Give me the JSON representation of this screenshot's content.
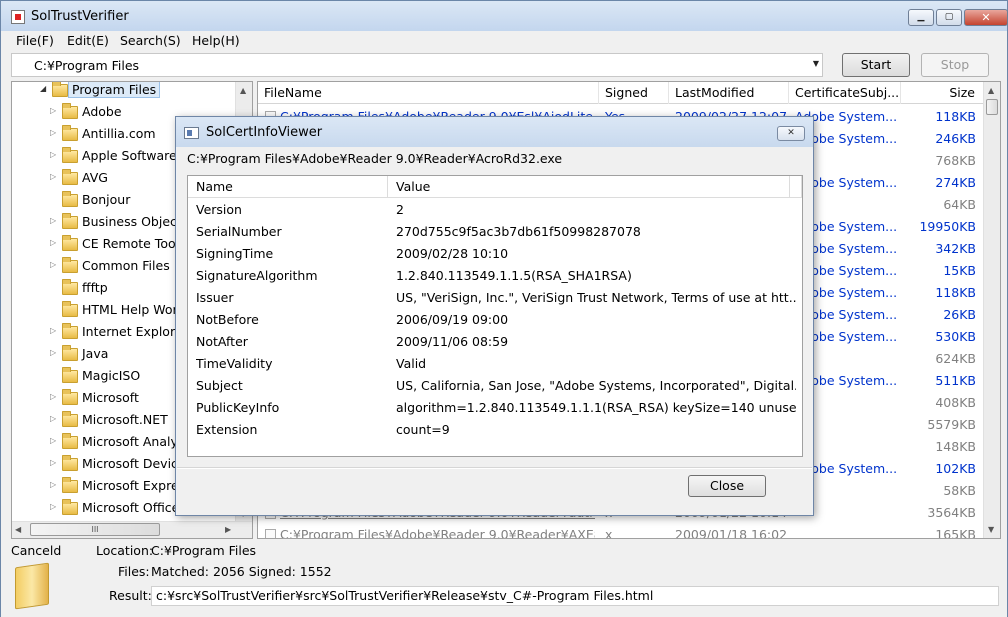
{
  "window": {
    "title": "SolTrustVerifier"
  },
  "menu": [
    "File(F)",
    "Edit(E)",
    "Search(S)",
    "Help(H)"
  ],
  "path_combo": {
    "value": "C:¥Program Files"
  },
  "buttons": {
    "start": "Start",
    "stop": "Stop"
  },
  "tree": {
    "root": "Program Files",
    "items": [
      {
        "label": "Adobe",
        "expandable": true
      },
      {
        "label": "Antillia.com",
        "expandable": true
      },
      {
        "label": "Apple Software",
        "expandable": true
      },
      {
        "label": "AVG",
        "expandable": true
      },
      {
        "label": "Bonjour",
        "expandable": false
      },
      {
        "label": "Business Object",
        "expandable": true
      },
      {
        "label": "CE Remote Tool",
        "expandable": true
      },
      {
        "label": "Common Files",
        "expandable": true
      },
      {
        "label": "ffftp",
        "expandable": false
      },
      {
        "label": "HTML Help Work",
        "expandable": false
      },
      {
        "label": "Internet Explore",
        "expandable": true
      },
      {
        "label": "Java",
        "expandable": true
      },
      {
        "label": "MagicISO",
        "expandable": false
      },
      {
        "label": "Microsoft",
        "expandable": true
      },
      {
        "label": "Microsoft.NET",
        "expandable": true
      },
      {
        "label": "Microsoft Analys",
        "expandable": true
      },
      {
        "label": "Microsoft Device",
        "expandable": true
      },
      {
        "label": "Microsoft Expres",
        "expandable": true
      },
      {
        "label": "Microsoft Office",
        "expandable": true
      }
    ],
    "hscroll_label": "III"
  },
  "list": {
    "columns": [
      "FileName",
      "Signed",
      "LastModified",
      "CertificateSubj...",
      "Size"
    ],
    "rows": [
      {
        "name": "C:¥Program Files¥Adobe¥Reader 9.0¥Esl¥AiodLite.dll",
        "signed": "Yes",
        "modified": "2009/02/27 12:07",
        "subject": "Adobe System...",
        "size": "118KB",
        "blue": true
      },
      {
        "name": "",
        "signed": "",
        "modified": "",
        "subject": "Adobe System...",
        "size": "246KB",
        "blue": true
      },
      {
        "name": "",
        "signed": "",
        "modified": "",
        "subject": "",
        "size": "768KB",
        "blue": false
      },
      {
        "name": "",
        "signed": "",
        "modified": "",
        "subject": "Adobe System...",
        "size": "274KB",
        "blue": true
      },
      {
        "name": "",
        "signed": "",
        "modified": "",
        "subject": "",
        "size": "64KB",
        "blue": false
      },
      {
        "name": "",
        "signed": "",
        "modified": "",
        "subject": "Adobe System...",
        "size": "19950KB",
        "blue": true
      },
      {
        "name": "",
        "signed": "",
        "modified": "",
        "subject": "Adobe System...",
        "size": "342KB",
        "blue": true
      },
      {
        "name": "",
        "signed": "",
        "modified": "",
        "subject": "Adobe System...",
        "size": "15KB",
        "blue": true
      },
      {
        "name": "",
        "signed": "",
        "modified": "",
        "subject": "Adobe System...",
        "size": "118KB",
        "blue": true
      },
      {
        "name": "",
        "signed": "",
        "modified": "",
        "subject": "Adobe System...",
        "size": "26KB",
        "blue": true
      },
      {
        "name": "",
        "signed": "",
        "modified": "",
        "subject": "Adobe System...",
        "size": "530KB",
        "blue": true
      },
      {
        "name": "",
        "signed": "",
        "modified": "",
        "subject": "",
        "size": "624KB",
        "blue": false
      },
      {
        "name": "",
        "signed": "",
        "modified": "",
        "subject": "Adobe System...",
        "size": "511KB",
        "blue": true
      },
      {
        "name": "",
        "signed": "",
        "modified": "",
        "subject": "",
        "size": "408KB",
        "blue": false
      },
      {
        "name": "",
        "signed": "",
        "modified": "",
        "subject": "",
        "size": "5579KB",
        "blue": false
      },
      {
        "name": "",
        "signed": "",
        "modified": "",
        "subject": "",
        "size": "148KB",
        "blue": false
      },
      {
        "name": "",
        "signed": "",
        "modified": "",
        "subject": "Adobe System...",
        "size": "102KB",
        "blue": true
      },
      {
        "name": "",
        "signed": "",
        "modified": "",
        "subject": "",
        "size": "58KB",
        "blue": false
      },
      {
        "name": "C:¥Program Files¥Adobe¥Reader 9.0¥Reader¥authplu...",
        "signed": "x",
        "modified": "2009/01/22 10:14",
        "subject": "",
        "size": "3564KB",
        "blue": false
      },
      {
        "name": "C:¥Program Files¥Adobe¥Reader 9.0¥Reader¥AXE8...",
        "signed": "x",
        "modified": "2009/01/18 16:02",
        "subject": "",
        "size": "165KB",
        "blue": false
      }
    ]
  },
  "status": {
    "state": "Canceld",
    "location_label": "Location:",
    "location_value": "C:¥Program Files",
    "files_label": "Files:",
    "files_value": "Matched: 2056  Signed: 1552",
    "result_label": "Result:",
    "result_value": "c:¥src¥SolTrustVerifier¥src¥SolTrustVerifier¥Release¥stv_C#-Program Files.html"
  },
  "dialog": {
    "title": "SolCertInfoViewer",
    "path": "C:¥Program Files¥Adobe¥Reader 9.0¥Reader¥AcroRd32.exe",
    "columns": [
      "Name",
      "Value"
    ],
    "rows": [
      {
        "name": "Version",
        "value": "2"
      },
      {
        "name": "SerialNumber",
        "value": "270d755c9f5ac3b7db61f50998287078"
      },
      {
        "name": "SigningTime",
        "value": "2009/02/28 10:10"
      },
      {
        "name": "SignatureAlgorithm",
        "value": "1.2.840.113549.1.1.5(RSA_SHA1RSA)"
      },
      {
        "name": "Issuer",
        "value": "US, \"VeriSign, Inc.\", VeriSign Trust Network, Terms of use at htt..."
      },
      {
        "name": "NotBefore",
        "value": "2006/09/19 09:00"
      },
      {
        "name": "NotAfter",
        "value": "2009/11/06 08:59"
      },
      {
        "name": "TimeValidity",
        "value": "Valid"
      },
      {
        "name": "Subject",
        "value": "US, California, San Jose, \"Adobe Systems, Incorporated\", Digital..."
      },
      {
        "name": "PublicKeyInfo",
        "value": "algorithm=1.2.840.113549.1.1.1(RSA_RSA) keySize=140 unuse..."
      },
      {
        "name": "Extension",
        "value": "count=9"
      }
    ],
    "close_label": "Close"
  }
}
